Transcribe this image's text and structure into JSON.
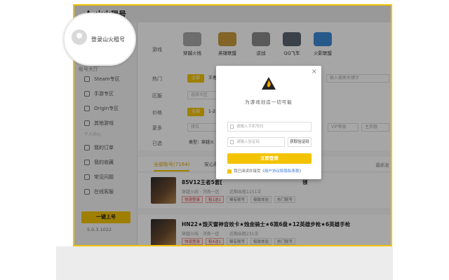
{
  "app": {
    "logo_text": "山火租号",
    "version": "5.0.3.1022"
  },
  "sidebar": {
    "top_label": "账号大厅",
    "top_suffix": "区",
    "items": [
      {
        "label": "Steam专区",
        "icon": "steam-icon"
      },
      {
        "label": "手游专区",
        "icon": "phone-icon"
      },
      {
        "label": "Origin专区",
        "icon": "origin-icon"
      },
      {
        "label": "其他游戏",
        "icon": "grid-icon"
      }
    ],
    "section_label": "个人中心",
    "personal_items": [
      {
        "label": "我的订单",
        "icon": "order-icon"
      },
      {
        "label": "我的收藏",
        "icon": "star-icon"
      },
      {
        "label": "常见问题",
        "icon": "help-icon"
      },
      {
        "label": "在线客服",
        "icon": "chat-icon"
      }
    ],
    "publish_label": "一键上号"
  },
  "login_badge": {
    "text": "登录山火租号"
  },
  "filters": {
    "game_label": "游戏",
    "games": [
      {
        "label": "穿越火线",
        "color": "#a8a8a8"
      },
      {
        "label": "英雄联盟",
        "color": "#c89b3c"
      },
      {
        "label": "逆战",
        "color": "#8a8a8a"
      },
      {
        "label": "QQ飞车",
        "color": "#5a6470"
      },
      {
        "label": "火影联盟",
        "color": "#3d8ad6"
      }
    ],
    "hot_label": "热门",
    "hot_all": "全部",
    "hot_king": "王者",
    "hot_search_placeholder": "输入搜索关键字",
    "region_label": "区服",
    "region_placeholder": "选择大区",
    "price_label": "价格",
    "price_all": "全部",
    "price_range": "1-2元",
    "more_label": "更多",
    "rank_placeholder": "排位",
    "vip_placeholder": "VIP等级",
    "main_placeholder": "主武器",
    "selected_label": "已选",
    "selected_value": "类型：穿越火"
  },
  "list": {
    "tab_all": "全部账号(7164)",
    "tab_safe": "安心账",
    "sort_label": "最新发",
    "items": [
      {
        "title": "85V12王者5套[",
        "title_tail": "领",
        "meta": "穿越火线 · 河南一区",
        "meta_tail": "近期出租1151次",
        "chips": [
          {
            "label": "快速登录",
            "red": true
          },
          {
            "label": "租1送1",
            "red": true
          },
          {
            "label": "稀有账号",
            "red": false
          },
          {
            "label": "极致体验",
            "red": false
          },
          {
            "label": "热门账号",
            "red": false
          }
        ]
      },
      {
        "title": "HN22★毁灭雷神音效卡★烛金骑士★6煞6盘★12英雄步枪★6英雄手枪",
        "title_tail": "",
        "meta": "穿越火线 · 河南一区",
        "meta_tail": "近期出租231次",
        "chips": [
          {
            "label": "快速登录",
            "red": true
          },
          {
            "label": "租4送1",
            "red": true
          },
          {
            "label": "稀有账号",
            "red": false
          },
          {
            "label": "极致体验",
            "red": false
          },
          {
            "label": "热门账号",
            "red": false
          }
        ]
      }
    ]
  },
  "login_modal": {
    "close_glyph": "×",
    "tagline": "为游戏创造一切可能",
    "phone_placeholder": "请输入手机号码",
    "code_placeholder": "请输入验证码",
    "get_code_label": "获取验证码",
    "submit_label": "立即登录",
    "agree_prefix": "我已阅读并接受《",
    "agree_link": "用户协议和隐私条款",
    "agree_suffix": "》"
  },
  "colors": {
    "accent": "#f3c300",
    "link": "#3a78d6",
    "danger": "#e24a4a"
  }
}
